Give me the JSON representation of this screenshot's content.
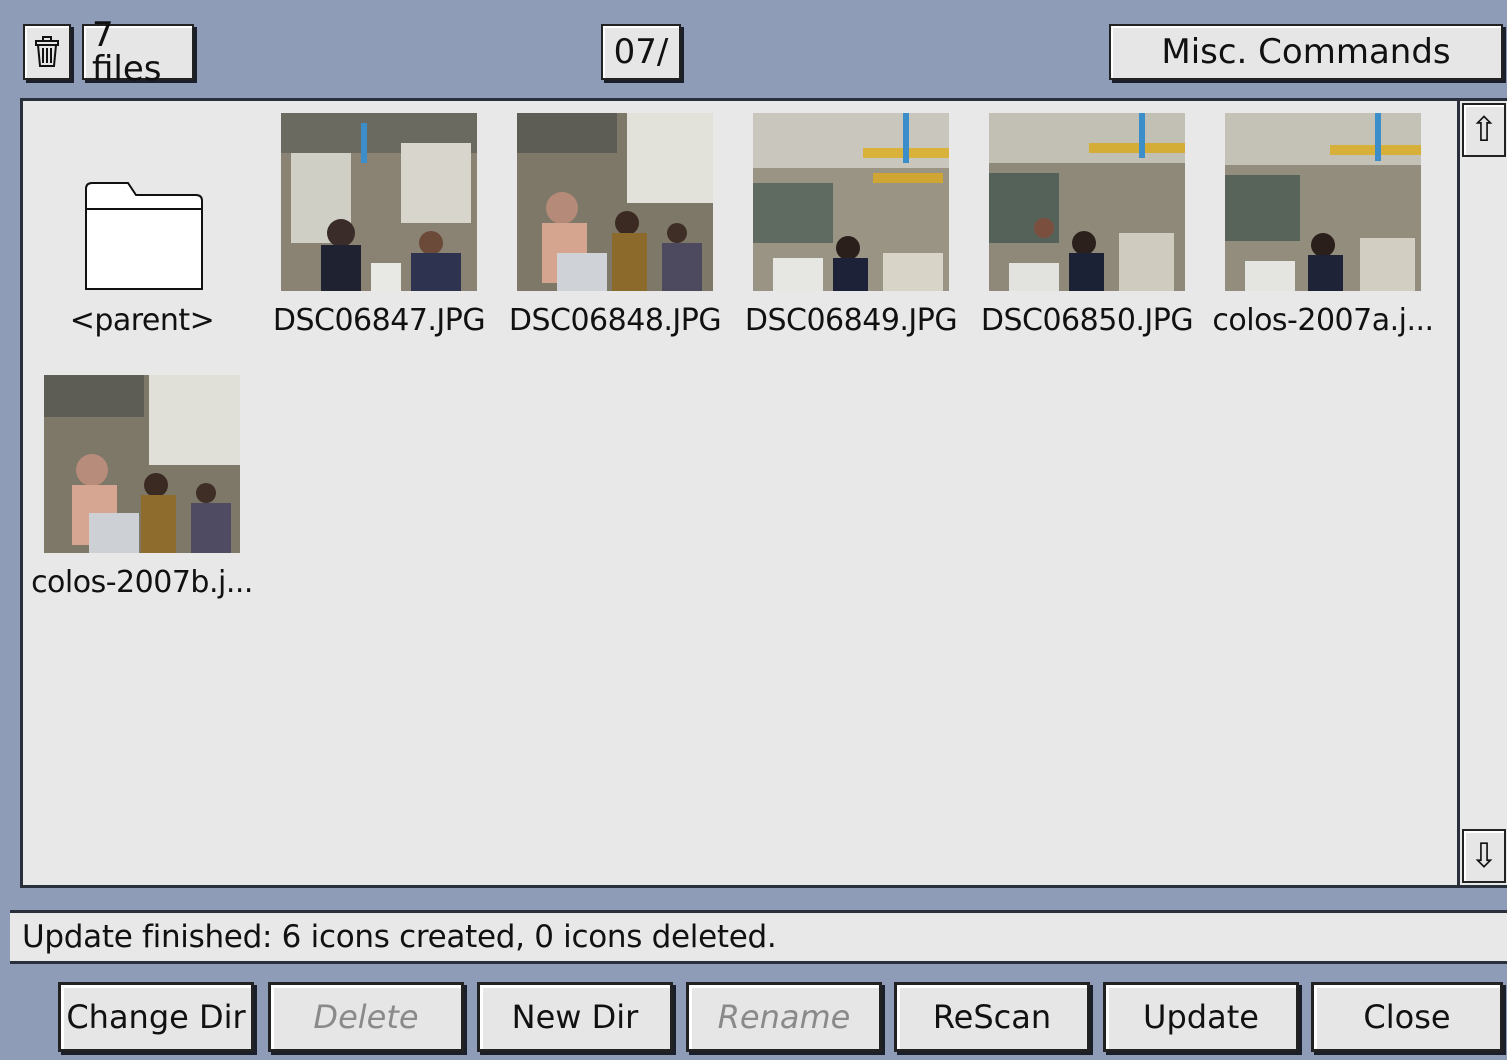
{
  "toolbar": {
    "trash_icon": "trash-icon",
    "file_count": "7 files",
    "path": "07/",
    "misc_label": "Misc. Commands"
  },
  "files": [
    {
      "name": "<parent>",
      "kind": "folder"
    },
    {
      "name": "DSC06847.JPG",
      "kind": "image"
    },
    {
      "name": "DSC06848.JPG",
      "kind": "image"
    },
    {
      "name": "DSC06849.JPG",
      "kind": "image"
    },
    {
      "name": "DSC06850.JPG",
      "kind": "image"
    },
    {
      "name": "colos-2007a.j...",
      "kind": "image"
    },
    {
      "name": "colos-2007b.j...",
      "kind": "image"
    }
  ],
  "scrollbar": {
    "up_icon": "⇧",
    "down_icon": "⇩"
  },
  "status": "Update finished:  6 icons created, 0 icons deleted.",
  "buttons": [
    {
      "label": "Change Dir",
      "enabled": true
    },
    {
      "label": "Delete",
      "enabled": false
    },
    {
      "label": "New Dir",
      "enabled": true
    },
    {
      "label": "Rename",
      "enabled": false
    },
    {
      "label": "ReScan",
      "enabled": true
    },
    {
      "label": "Update",
      "enabled": true
    },
    {
      "label": "Close",
      "enabled": true
    }
  ],
  "colors": {
    "window": "#8e9cb8",
    "panel": "#e8e8e8",
    "button": "#e6e6e6"
  }
}
